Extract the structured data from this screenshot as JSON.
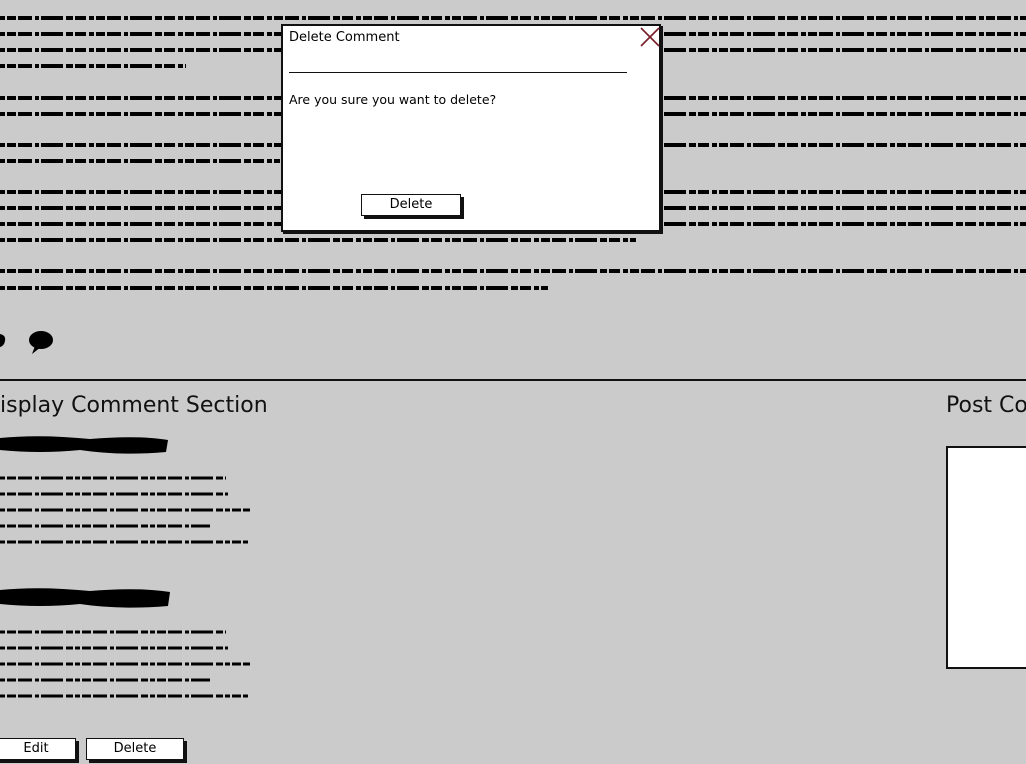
{
  "colors": {
    "background": "#cbcbcb",
    "close_icon": "#7a1c28"
  },
  "display_section": {
    "title": "isplay Comment Section",
    "edit_label": "Edit",
    "delete_label": "Delete"
  },
  "post_section": {
    "title": "Post Co"
  },
  "modal": {
    "title": "Delete Comment",
    "message": "Are you sure you want to delete?",
    "delete_label": "Delete",
    "close_icon": "close-icon"
  },
  "icons": [
    "partial-icon",
    "speech-bubble-icon"
  ]
}
